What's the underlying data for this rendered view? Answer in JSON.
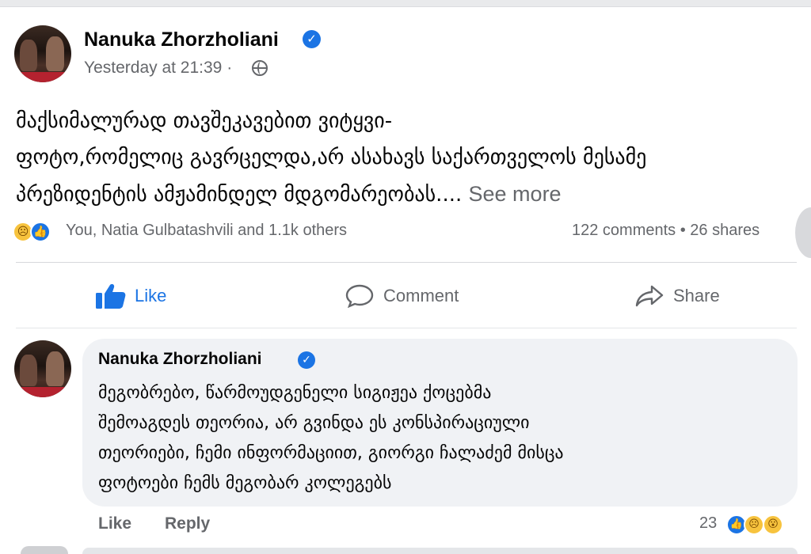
{
  "post": {
    "author": "Nanuka Zhorzholiani",
    "timestamp": "Yesterday at 21:39 ·",
    "body_lines": [
      "მაქსიმალურად თავშეკავებით ვიტყვი-",
      "ფოტო,რომელიც გავრცელდა,არ ასახავს საქართველოს მესამე",
      "პრეზიდენტის ამჟამინდელ მდგომარეობას...."
    ],
    "see_more": "See more",
    "reactions_text": "You, Natia Gulbatashvili and 1.1k others",
    "counts_text": "122 comments • 26 shares",
    "icons": {
      "verified": "verified-badge-icon",
      "globe": "globe-icon",
      "sad": "sad-reaction-icon",
      "like": "like-reaction-icon"
    }
  },
  "actions": {
    "like": "Like",
    "comment": "Comment",
    "share": "Share"
  },
  "comment": {
    "author": "Nanuka Zhorzholiani",
    "body_lines": [
      "მეგობრებო, წარმოუდგენელი სიგიჟეა ქოცებმა",
      "შემოაგდეს თეორია, არ გვინდა ეს კონსპირაციული",
      "თეორიები, ჩემი ინფორმაციით, გიორგი ჩალაძემ მისცა",
      "ფოტოები ჩემს მეგობარ კოლეგებს"
    ],
    "like_label": "Like",
    "reply_label": "Reply",
    "reaction_count": "23",
    "reaction_icons": [
      "like-reaction-icon",
      "sad-reaction-icon",
      "wow-reaction-icon"
    ]
  },
  "colors": {
    "accent": "#1b74e4",
    "secondary_text": "#65676b",
    "bubble_bg": "#f0f2f5"
  }
}
